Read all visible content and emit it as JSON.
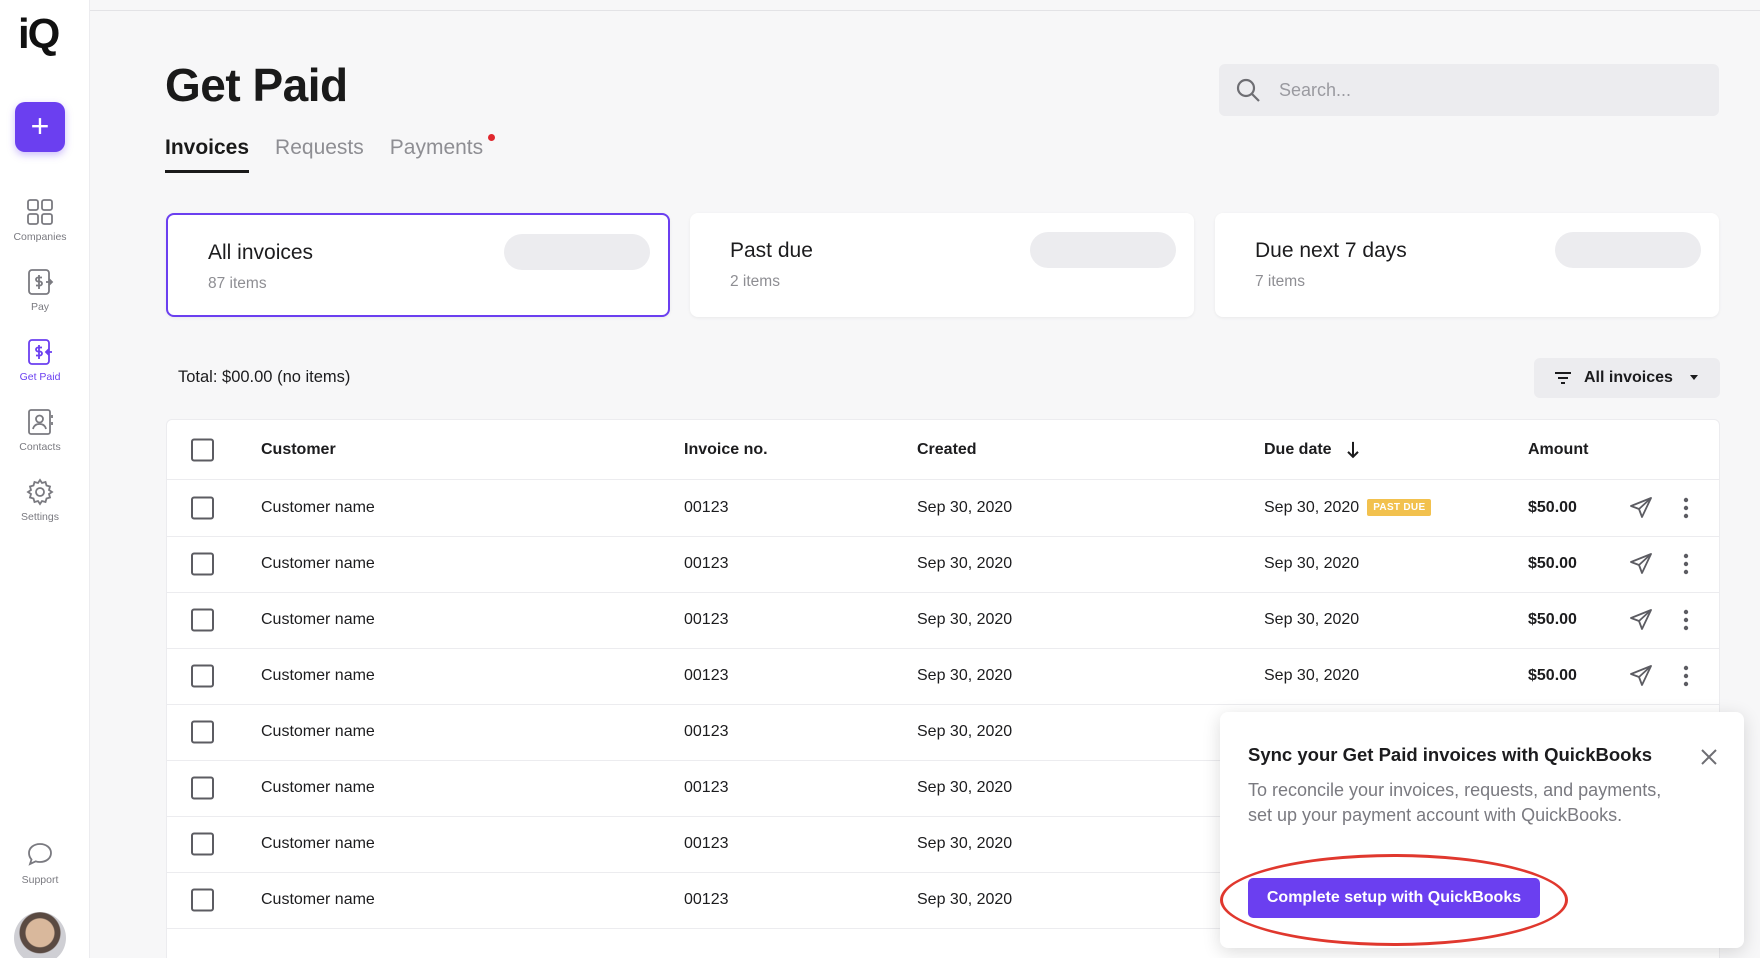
{
  "app": {
    "logo_text": "iQ"
  },
  "sidebar": {
    "add_label": "+",
    "items": [
      {
        "label": "Companies",
        "icon": "grid-icon"
      },
      {
        "label": "Pay",
        "icon": "pay-icon"
      },
      {
        "label": "Get Paid",
        "icon": "get-paid-icon",
        "active": true
      },
      {
        "label": "Contacts",
        "icon": "contacts-icon"
      },
      {
        "label": "Settings",
        "icon": "gear-icon"
      },
      {
        "label": "Support",
        "icon": "chat-icon"
      }
    ]
  },
  "header": {
    "title": "Get Paid",
    "search_placeholder": "Search..."
  },
  "tabs": [
    {
      "label": "Invoices",
      "active": true
    },
    {
      "label": "Requests"
    },
    {
      "label": "Payments",
      "notification": true
    }
  ],
  "summary_cards": [
    {
      "title": "All invoices",
      "subtitle": "87 items",
      "active": true
    },
    {
      "title": "Past due",
      "subtitle": "2 items"
    },
    {
      "title": "Due next 7 days",
      "subtitle": "7 items"
    }
  ],
  "toolbar": {
    "total": "Total:  $00.00 (no items)",
    "filter_label": "All invoices"
  },
  "table": {
    "columns": [
      "Customer",
      "Invoice no.",
      "Created",
      "Due date",
      "Amount"
    ],
    "rows": [
      {
        "customer": "Customer name",
        "invoice": "00123",
        "created": "Sep 30, 2020",
        "due": "Sep 30, 2020",
        "badge": "PAST DUE",
        "amount": "$50.00"
      },
      {
        "customer": "Customer name",
        "invoice": "00123",
        "created": "Sep 30, 2020",
        "due": "Sep 30, 2020",
        "badge": "",
        "amount": "$50.00"
      },
      {
        "customer": "Customer name",
        "invoice": "00123",
        "created": "Sep 30, 2020",
        "due": "Sep 30, 2020",
        "badge": "",
        "amount": "$50.00"
      },
      {
        "customer": "Customer name",
        "invoice": "00123",
        "created": "Sep 30, 2020",
        "due": "Sep 30, 2020",
        "badge": "",
        "amount": "$50.00"
      },
      {
        "customer": "Customer name",
        "invoice": "00123",
        "created": "Sep 30, 2020",
        "due": "",
        "badge": "",
        "amount": ""
      },
      {
        "customer": "Customer name",
        "invoice": "00123",
        "created": "Sep 30, 2020",
        "due": "",
        "badge": "",
        "amount": ""
      },
      {
        "customer": "Customer name",
        "invoice": "00123",
        "created": "Sep 30, 2020",
        "due": "",
        "badge": "",
        "amount": ""
      },
      {
        "customer": "Customer name",
        "invoice": "00123",
        "created": "Sep 30, 2020",
        "due": "",
        "badge": "",
        "amount": ""
      }
    ]
  },
  "popover": {
    "title": "Sync your Get Paid invoices with QuickBooks",
    "body": "To reconcile your invoices, requests, and payments, set up your payment account with QuickBooks.",
    "cta": "Complete setup with QuickBooks"
  },
  "colors": {
    "accent": "#6b3ff0",
    "badge": "#f2c14e",
    "highlight": "#e0382e"
  }
}
